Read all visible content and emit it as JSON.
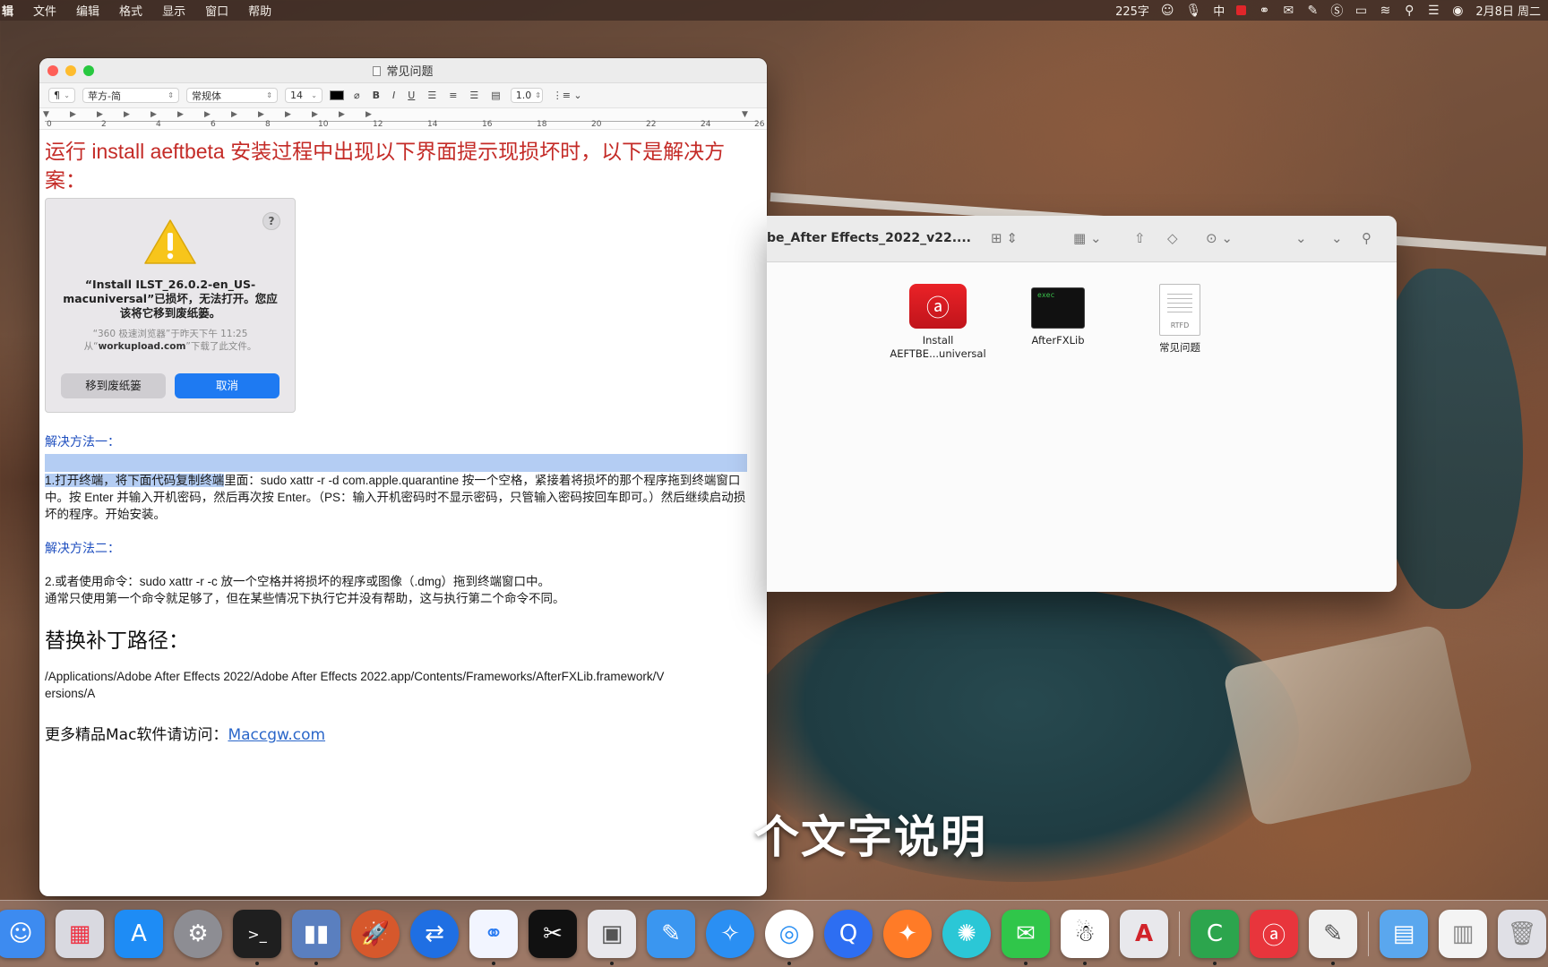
{
  "menubar": {
    "app_fragment": "辑",
    "menus": [
      "文件",
      "编辑",
      "格式",
      "显示",
      "窗口",
      "帮助"
    ],
    "status": {
      "word_count": "225字",
      "input_method": "中",
      "date": "2月8日 周二"
    }
  },
  "textedit": {
    "title": "常见问题",
    "toolbar": {
      "paragraph_style": "¶",
      "font_family": "苹方-简",
      "font_style": "常规体",
      "font_size": "14",
      "bold": "B",
      "italic": "I",
      "underline": "U",
      "line_spacing": "1.0"
    },
    "ruler_numbers": [
      "0",
      "2",
      "4",
      "6",
      "8",
      "10",
      "12",
      "14",
      "16",
      "18",
      "20",
      "22",
      "24",
      "26"
    ],
    "heading_red": "运行 install aeftbeta 安装过程中出现以下界面提示现损坏时，以下是解决方案：",
    "alert": {
      "message": "“Install ILST_26.0.2-en_US-macuniversal”已损坏，无法打开。您应该将它移到废纸篓。",
      "sub_pre": "“360 极速浏览器”于昨天下午 11:25 从“",
      "sub_site": "workupload.com",
      "sub_post": "”下载了此文件。",
      "trash_button": "移到废纸篓",
      "cancel_button": "取消",
      "help": "?"
    },
    "method1_label": "解决方法一：",
    "method1_selected": "1.打开终端，将下面代码复制终端",
    "method1_text": "里面：sudo xattr -r -d com.apple.quarantine 按一个空格，紧接着将损坏的那个程序拖到终端窗口中。按 Enter 并输入开机密码，然后再次按 Enter。（PS：输入开机密码时不显示密码，只管输入密码按回车即可。）然后继续启动损坏的程序。开始安装。",
    "method2_label": "解决方法二：",
    "method2_line1": "2.或者使用命令：sudo xattr -r -c 放一个空格并将损坏的程序或图像（.dmg）拖到终端窗口中。",
    "method2_line2": "通常只使用第一个命令就足够了，但在某些情况下执行它并没有帮助，这与执行第二个命令不同。",
    "patch_heading": "替换补丁路径：",
    "patch_path": "/Applications/Adobe After Effects 2022/Adobe After Effects 2022.app/Contents/Frameworks/AfterFXLib.framework/Versions/A",
    "more_label": "更多精品Mac软件请访问：",
    "more_link": "Maccgw.com"
  },
  "finder": {
    "title": "be_After Effects_2022_v22....",
    "files": [
      {
        "name": "Install AEFTBE...universal",
        "icon": "creative-cloud-icon"
      },
      {
        "name": "AfterFXLib",
        "icon": "exec-icon",
        "badge": "exec"
      },
      {
        "name": "常见问题",
        "icon": "rtfd-icon",
        "badge": "RTFD"
      }
    ]
  },
  "subtitle": "个文字说明",
  "dock": {
    "apps": [
      {
        "name": "finder",
        "color": "#3d8bf0"
      },
      {
        "name": "launchpad",
        "color": "#d9d9e0"
      },
      {
        "name": "app-store",
        "color": "#1e8cf5"
      },
      {
        "name": "system-preferences",
        "color": "#8d8d93"
      },
      {
        "name": "terminal",
        "color": "#1f1f1f"
      },
      {
        "name": "parallels",
        "color": "#5a7fbf"
      },
      {
        "name": "rocket-typist",
        "color": "#d6582c"
      },
      {
        "name": "teamviewer",
        "color": "#1f6fe3"
      },
      {
        "name": "baidu-netdisk",
        "color": "#f2f5ff"
      },
      {
        "name": "capcut",
        "color": "#111111"
      },
      {
        "name": "preview",
        "color": "#e8e8ec"
      },
      {
        "name": "pages",
        "color": "#3a96f0"
      },
      {
        "name": "safari",
        "color": "#2a8ff3"
      },
      {
        "name": "chrome",
        "color": "#ffffff"
      },
      {
        "name": "quark",
        "color": "#2d6ef2"
      },
      {
        "name": "firefox",
        "color": "#ff7b27"
      },
      {
        "name": "xunlei",
        "color": "#2bc7d6"
      },
      {
        "name": "wechat",
        "color": "#30c64a"
      },
      {
        "name": "qq",
        "color": "#ffffff"
      },
      {
        "name": "autocad",
        "color": "#e8e8ec"
      },
      {
        "name": "camtasia",
        "color": "#2ca54d"
      },
      {
        "name": "creative-cloud",
        "color": "#e8353c"
      },
      {
        "name": "textedit",
        "color": "#f0f0f0"
      },
      {
        "name": "downloads-folder",
        "color": "#5aa7ee"
      },
      {
        "name": "document-stack",
        "color": "#f4f4f4"
      },
      {
        "name": "trash",
        "color": "#e0e0e6"
      }
    ]
  }
}
